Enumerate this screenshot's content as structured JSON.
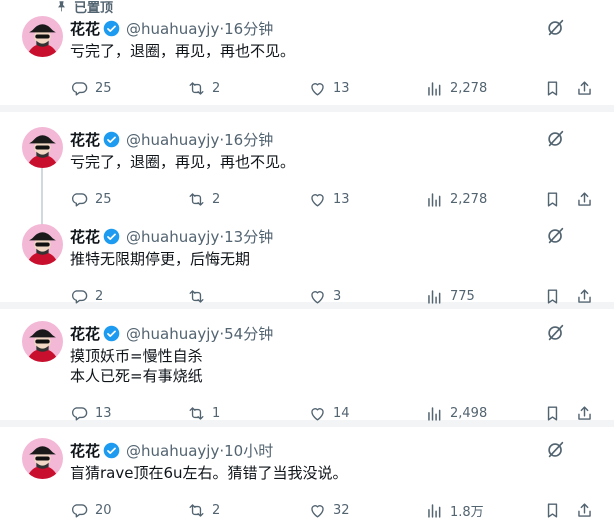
{
  "pinned_label": "已置顶",
  "tweets": [
    {
      "name": "花花",
      "handle": "@huahuayjy",
      "time": "16分钟",
      "lines": [
        "亏完了，退圈，再见，再也不见。"
      ],
      "replies": "25",
      "retweets": "2",
      "likes": "13",
      "views": "2,278"
    },
    {
      "name": "花花",
      "handle": "@huahuayjy",
      "time": "16分钟",
      "lines": [
        "亏完了，退圈，再见，再也不见。"
      ],
      "replies": "25",
      "retweets": "2",
      "likes": "13",
      "views": "2,278"
    },
    {
      "name": "花花",
      "handle": "@huahuayjy",
      "time": "13分钟",
      "lines": [
        "推特无限期停更，后悔无期"
      ],
      "replies": "2",
      "retweets": "",
      "likes": "3",
      "views": "775"
    },
    {
      "name": "花花",
      "handle": "@huahuayjy",
      "time": "54分钟",
      "lines": [
        "摸顶妖币=慢性自杀",
        "本人已死=有事烧纸"
      ],
      "replies": "13",
      "retweets": "1",
      "likes": "14",
      "views": "2,498"
    },
    {
      "name": "花花",
      "handle": "@huahuayjy",
      "time": "10小时",
      "lines": [
        "盲猜rave顶在6u左右。猜错了当我没说。"
      ],
      "replies": "20",
      "retweets": "2",
      "likes": "32",
      "views": "1.8万"
    }
  ],
  "colors": {
    "verified": "#1d9bf0",
    "muted": "#536471",
    "divider": "#eff3f4"
  }
}
